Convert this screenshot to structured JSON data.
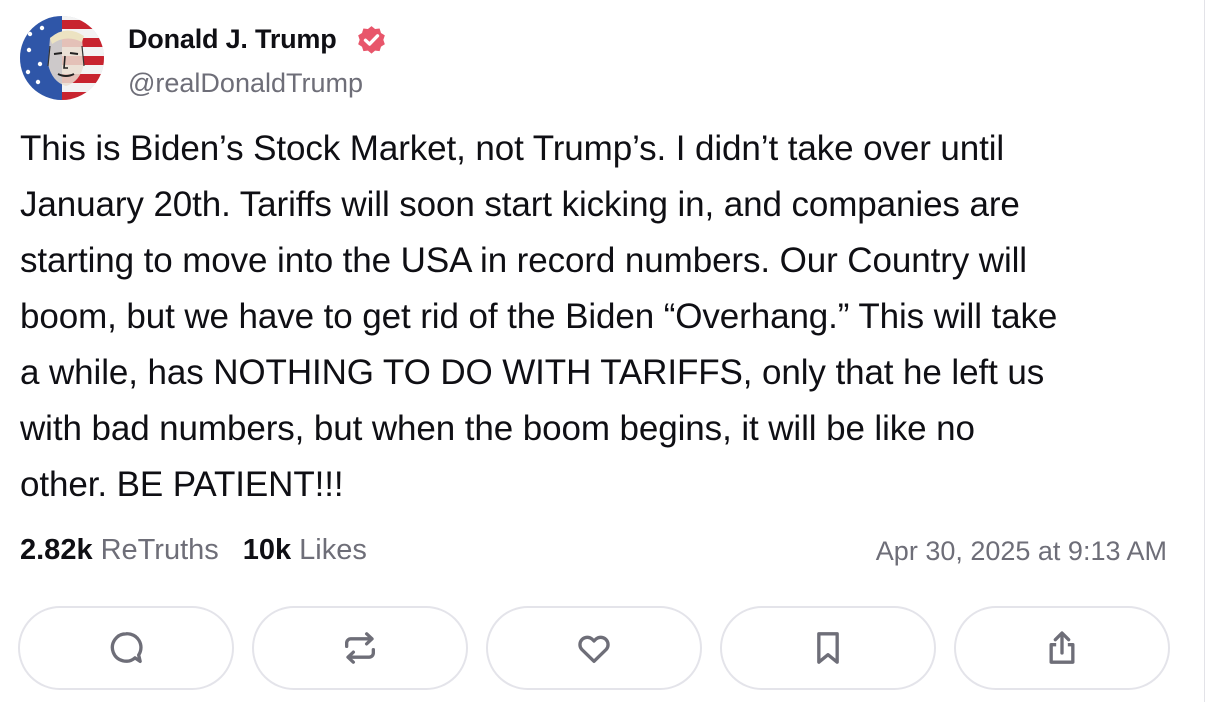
{
  "author": {
    "display_name": "Donald J. Trump",
    "handle": "@realDonaldTrump",
    "verified": true,
    "avatar_icon": "flag-portrait-avatar"
  },
  "post": {
    "lines": [
      "This is Biden’s Stock Market, not Trump’s. I didn’t take over until",
      "January 20th. Tariffs will soon start kicking in, and companies are",
      "starting to move into the USA in record numbers. Our Country will",
      "boom, but we have to get rid of the Biden “Overhang.” This will take",
      "a while, has NOTHING TO DO WITH TARIFFS, only that he left us",
      "with bad numbers, but when the boom begins, it will be like no",
      "other. BE PATIENT!!!"
    ]
  },
  "stats": {
    "retruths_count": "2.82k",
    "retruths_label": "ReTruths",
    "likes_count": "10k",
    "likes_label": "Likes"
  },
  "timestamp": "Apr 30, 2025 at 9:13 AM",
  "actions": [
    {
      "icon": "reply-icon"
    },
    {
      "icon": "retruth-icon"
    },
    {
      "icon": "like-icon"
    },
    {
      "icon": "bookmark-icon"
    },
    {
      "icon": "share-icon"
    }
  ],
  "colors": {
    "text": "#0f0f14",
    "muted": "#6e6e78",
    "verified_badge": "#e8566b",
    "button_border": "#e4e4ea",
    "icon": "#6e6e78"
  }
}
